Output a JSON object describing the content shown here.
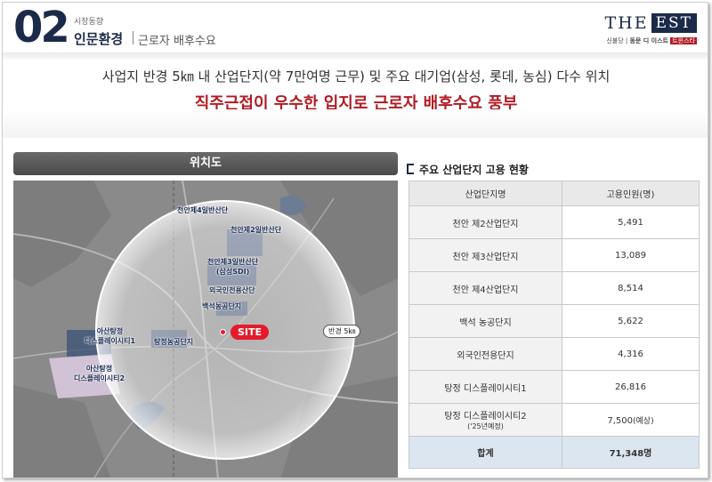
{
  "header": {
    "section_number": "02",
    "section_subtitle": "시장동향",
    "section_title": "인문환경",
    "section_desc": "근로자 배후수요"
  },
  "logo": {
    "the": "THE",
    "est": "EST",
    "line1": "신불당",
    "line2": "동문 디 이스트",
    "badge": "트윈스타"
  },
  "headline": {
    "line1": "사업지 반경 5㎞ 내 산업단지(약 7만여명 근무) 및 주요 대기업(삼성, 롯데, 농심) 다수 위치",
    "line2": "직주근접이 우수한 입지로 근로자 배후수요 풍부"
  },
  "map": {
    "title": "위치도",
    "site_label": "SITE",
    "radius_label": "반경 5㎞",
    "places": [
      {
        "id": "cheonan4",
        "label": "천안제4일반산단"
      },
      {
        "id": "cheonan2",
        "label": "천안제2일반산단"
      },
      {
        "id": "cheonan3",
        "label": "천안제3일반산단\n(삼성SDI)"
      },
      {
        "id": "foreign",
        "label": "외국인전용산단"
      },
      {
        "id": "baekseok",
        "label": "백석농공단지"
      },
      {
        "id": "tangjeong",
        "label": "탕정농공단지"
      },
      {
        "id": "asan1",
        "label": "아산탕정\n디스플레이시티1"
      },
      {
        "id": "asan2",
        "label": "아산탕정\n디스플레이시티2"
      }
    ]
  },
  "table": {
    "title": "주요 산업단지 고용 현황",
    "headers": [
      "산업단지명",
      "고용인원(명)"
    ],
    "rows": [
      {
        "name": "천안 제2산업단지",
        "value": "5,491"
      },
      {
        "name": "천안 제3산업단지",
        "value": "13,089"
      },
      {
        "name": "천안 제4산업단지",
        "value": "8,514"
      },
      {
        "name": "백석 농공단지",
        "value": "5,622"
      },
      {
        "name": "외국인전용단지",
        "value": "4,316"
      },
      {
        "name": "탕정 디스플레이시티1",
        "value": "26,816"
      },
      {
        "name": "탕정 디스플레이시티2",
        "note": "('25년예정)",
        "value": "7,500",
        "value_note": "(예상)"
      }
    ],
    "total": {
      "name": "합계",
      "value": "71,348명"
    }
  }
}
